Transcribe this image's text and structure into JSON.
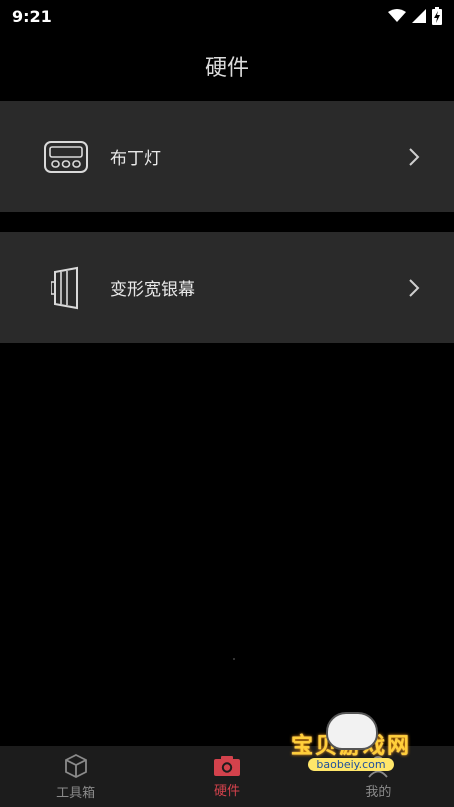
{
  "status": {
    "time": "9:21"
  },
  "header": {
    "title": "硬件"
  },
  "items": [
    {
      "label": "布丁灯",
      "icon": "pudding-lamp-icon"
    },
    {
      "label": "变形宽银幕",
      "icon": "anamorphic-screen-icon"
    }
  ],
  "tabs": [
    {
      "label": "工具箱",
      "icon": "cube-icon",
      "active": false
    },
    {
      "label": "硬件",
      "icon": "camera-icon",
      "active": true
    },
    {
      "label": "我的",
      "icon": "user-icon",
      "active": false
    }
  ],
  "watermark": {
    "text": "宝贝游戏网",
    "url": "baobeiy.com"
  },
  "colors": {
    "accent": "#d3424c",
    "row_bg": "#2a2a2a",
    "background": "#000000"
  }
}
